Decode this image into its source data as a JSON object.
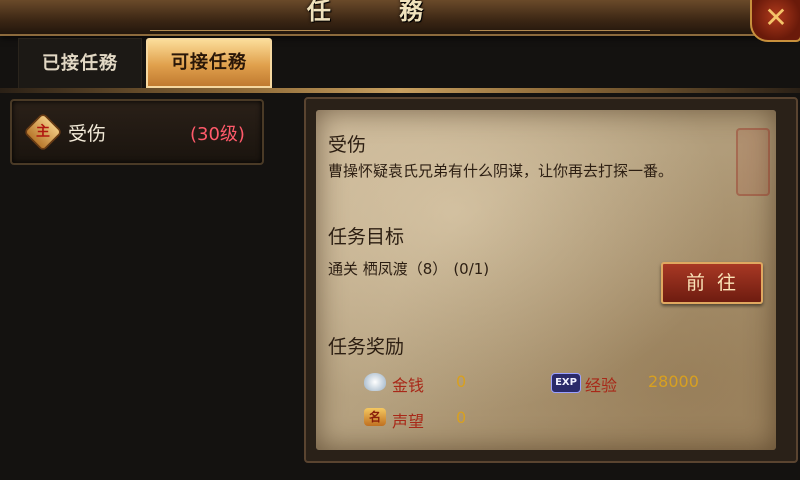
{
  "header": {
    "title": "任 務",
    "close_label": "✕"
  },
  "tabs": [
    {
      "label": "已接任務",
      "active": false
    },
    {
      "label": "可接任務",
      "active": true
    }
  ],
  "quest_list": [
    {
      "badge": "主",
      "name": "受伤",
      "level": "(30级)"
    }
  ],
  "detail": {
    "title": "受伤",
    "description": "曹操怀疑袁氏兄弟有什么阴谋，让你再去打探一番。",
    "goal_heading": "任务目标",
    "goal_text": "通关 栖凤渡（8）",
    "goal_progress": "(0/1)",
    "go_button": "前往",
    "reward_heading": "任务奖励",
    "rewards": {
      "gold_label": "金钱",
      "gold_value": "0",
      "exp_badge": "EXP",
      "exp_label": "经验",
      "exp_value": "28000",
      "fame_badge": "名",
      "fame_label": "声望",
      "fame_value": "0"
    }
  },
  "colors": {
    "level": "#ff5a6a",
    "reward_label": "#a82818",
    "reward_value": "#d8a020",
    "button": "#a83824"
  }
}
